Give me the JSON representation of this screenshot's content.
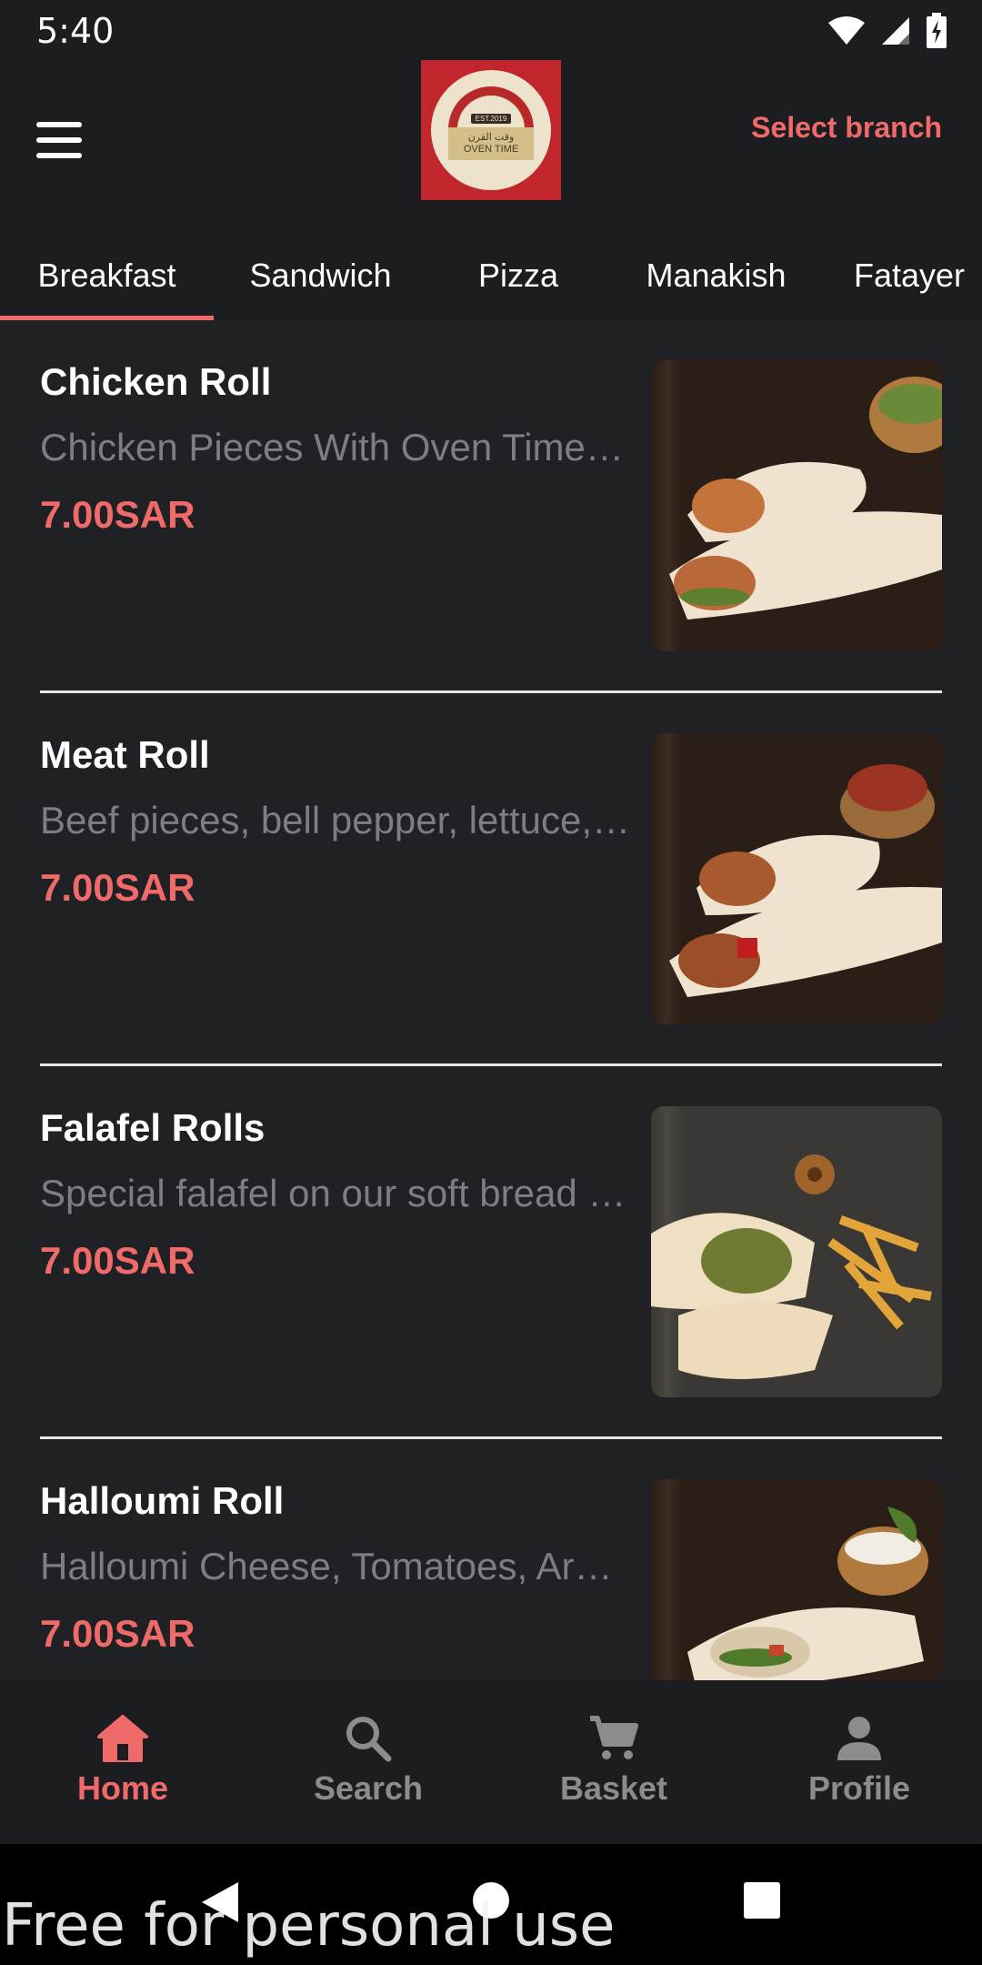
{
  "status": {
    "time": "5:40"
  },
  "header": {
    "logo": {
      "est": "EST.2019",
      "arabic": "وقت الفرن",
      "name": "OVEN TIME"
    },
    "select_branch": "Select branch"
  },
  "tabs": [
    {
      "label": "Breakfast",
      "active": true
    },
    {
      "label": "Sandwich"
    },
    {
      "label": "Pizza"
    },
    {
      "label": "Manakish"
    },
    {
      "label": "Fatayer"
    }
  ],
  "items": [
    {
      "title": "Chicken Roll",
      "desc": "Chicken Pieces With Oven Time Sauce, Lettuce",
      "price": "7.00SAR"
    },
    {
      "title": "Meat Roll",
      "desc": "Beef pieces, bell pepper, lettuce, onion",
      "price": "7.00SAR"
    },
    {
      "title": "Falafel Rolls",
      "desc": "Special falafel on our soft bread with tahini",
      "price": "7.00SAR"
    },
    {
      "title": "Halloumi Roll",
      "desc": "Halloumi Cheese, Tomatoes, Arugula",
      "price": "7.00SAR"
    }
  ],
  "bottom_nav": [
    {
      "label": "Home",
      "icon": "home-icon",
      "active": true
    },
    {
      "label": "Search",
      "icon": "search-icon"
    },
    {
      "label": "Basket",
      "icon": "cart-icon"
    },
    {
      "label": "Profile",
      "icon": "person-icon"
    }
  ],
  "watermark": "Free for personal use",
  "colors": {
    "accent": "#f06a6a",
    "background": "#1f2125",
    "bar": "#1b1d21"
  }
}
